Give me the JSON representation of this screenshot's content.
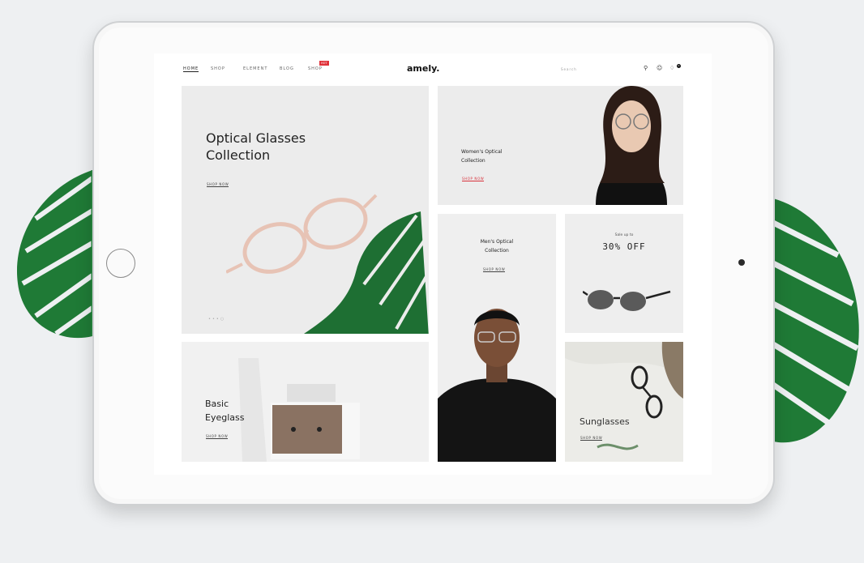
{
  "nav": {
    "items": [
      "Home",
      "Shop",
      "Element",
      "Blog",
      "Shop"
    ],
    "badge": "HOT",
    "logo": "amely.",
    "search_placeholder": "Search",
    "cart_count": "0",
    "icons": [
      "search-icon",
      "user-icon",
      "cart-icon"
    ]
  },
  "tiles": {
    "optical": {
      "title_line1": "Optical Glasses",
      "title_line2": "Collection",
      "link": "SHOP NOW"
    },
    "women": {
      "title_line1": "Women's Optical",
      "title_line2": "Collection",
      "link": "SHOP NOW"
    },
    "men": {
      "title_line1": "Men's Optical",
      "title_line2": "Collection",
      "link": "SHOP NOW"
    },
    "sale": {
      "pre": "Sale up to",
      "headline": "30% OFF"
    },
    "basic": {
      "title_line1": "Basic",
      "title_line2": "Eyeglass",
      "link": "SHOP NOW"
    },
    "sun": {
      "title": "Sunglasses",
      "link": "SHOP NOW"
    }
  },
  "colors": {
    "accent": "#d8323c",
    "leaf": "#1f7a36",
    "tile_bg": "#ececec"
  }
}
